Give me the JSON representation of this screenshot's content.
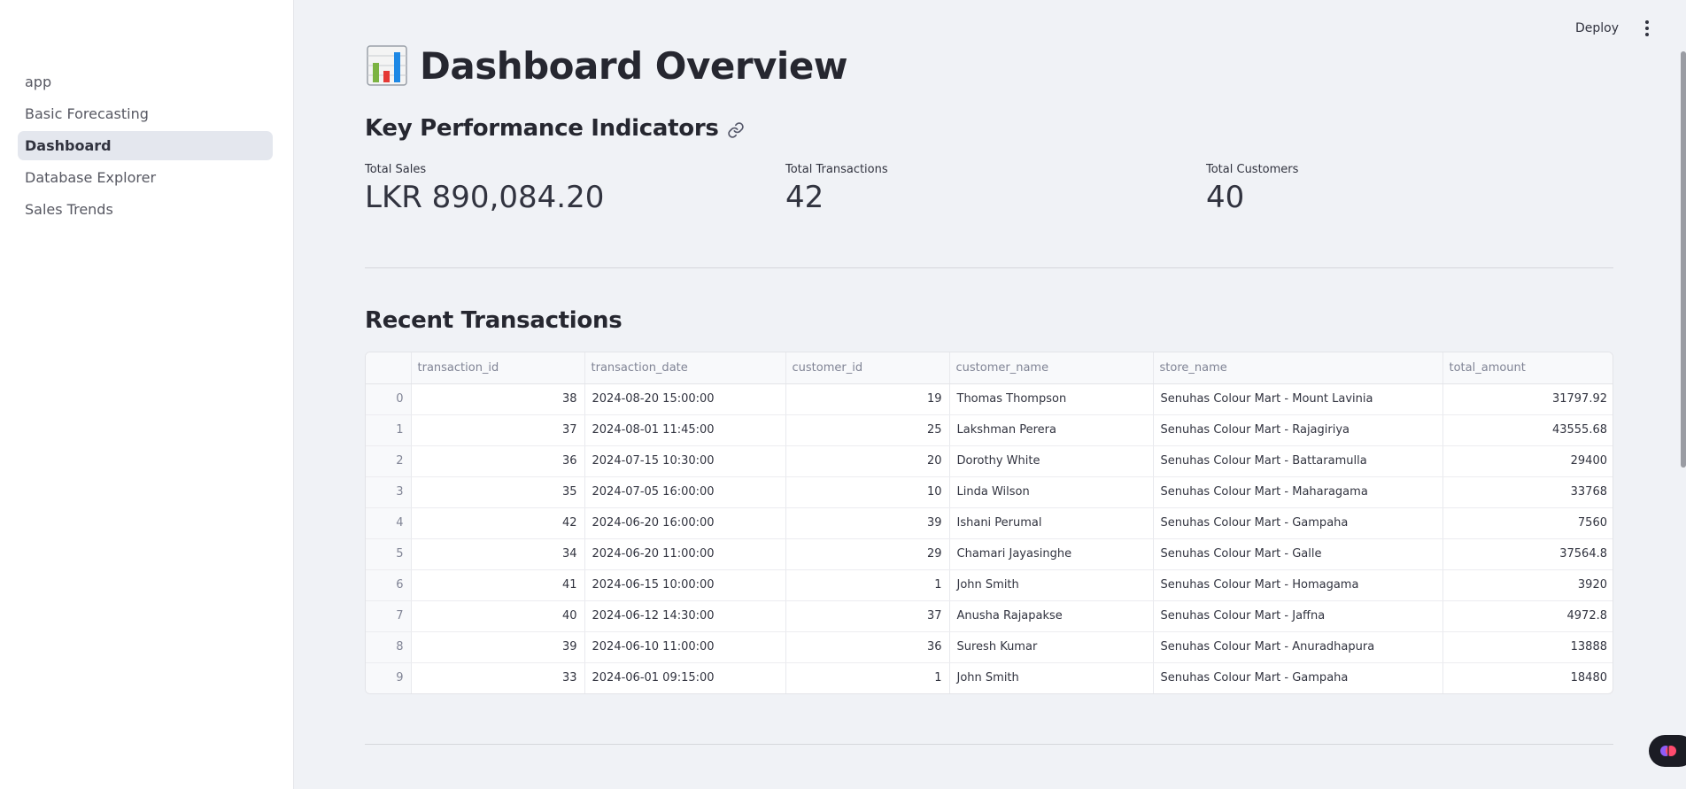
{
  "sidebar": {
    "items": [
      {
        "label": "app",
        "active": false
      },
      {
        "label": "Basic Forecasting",
        "active": false
      },
      {
        "label": "Dashboard",
        "active": true
      },
      {
        "label": "Database Explorer",
        "active": false
      },
      {
        "label": "Sales Trends",
        "active": false
      }
    ]
  },
  "header": {
    "deploy_label": "Deploy",
    "menu_icon": "kebab-menu-icon"
  },
  "page": {
    "title_icon": "bar-chart-icon",
    "title": "Dashboard Overview"
  },
  "kpi": {
    "heading": "Key Performance Indicators",
    "metrics": [
      {
        "label": "Total Sales",
        "value": "LKR 890,084.20"
      },
      {
        "label": "Total Transactions",
        "value": "42"
      },
      {
        "label": "Total Customers",
        "value": "40"
      }
    ]
  },
  "recent": {
    "heading": "Recent Transactions",
    "columns": [
      "",
      "transaction_id",
      "transaction_date",
      "customer_id",
      "customer_name",
      "store_name",
      "total_amount"
    ],
    "rows": [
      [
        "0",
        "38",
        "2024-08-20 15:00:00",
        "19",
        "Thomas Thompson",
        "Senuhas Colour Mart - Mount Lavinia",
        "31797.92"
      ],
      [
        "1",
        "37",
        "2024-08-01 11:45:00",
        "25",
        "Lakshman Perera",
        "Senuhas Colour Mart - Rajagiriya",
        "43555.68"
      ],
      [
        "2",
        "36",
        "2024-07-15 10:30:00",
        "20",
        "Dorothy White",
        "Senuhas Colour Mart - Battaramulla",
        "29400"
      ],
      [
        "3",
        "35",
        "2024-07-05 16:00:00",
        "10",
        "Linda Wilson",
        "Senuhas Colour Mart - Maharagama",
        "33768"
      ],
      [
        "4",
        "42",
        "2024-06-20 16:00:00",
        "39",
        "Ishani Perumal",
        "Senuhas Colour Mart - Gampaha",
        "7560"
      ],
      [
        "5",
        "34",
        "2024-06-20 11:00:00",
        "29",
        "Chamari Jayasinghe",
        "Senuhas Colour Mart - Galle",
        "37564.8"
      ],
      [
        "6",
        "41",
        "2024-06-15 10:00:00",
        "1",
        "John Smith",
        "Senuhas Colour Mart - Homagama",
        "3920"
      ],
      [
        "7",
        "40",
        "2024-06-12 14:30:00",
        "37",
        "Anusha Rajapakse",
        "Senuhas Colour Mart - Jaffna",
        "4972.8"
      ],
      [
        "8",
        "39",
        "2024-06-10 11:00:00",
        "36",
        "Suresh Kumar",
        "Senuhas Colour Mart - Anuradhapura",
        "13888"
      ],
      [
        "9",
        "33",
        "2024-06-01 09:15:00",
        "1",
        "John Smith",
        "Senuhas Colour Mart - Gampaha",
        "18480"
      ]
    ]
  },
  "colors": {
    "sidebar_bg": "#ffffff",
    "main_bg": "#f0f2f6",
    "active_item_bg": "#e4e7ee",
    "text": "#31333f",
    "header_text": "#808495"
  }
}
